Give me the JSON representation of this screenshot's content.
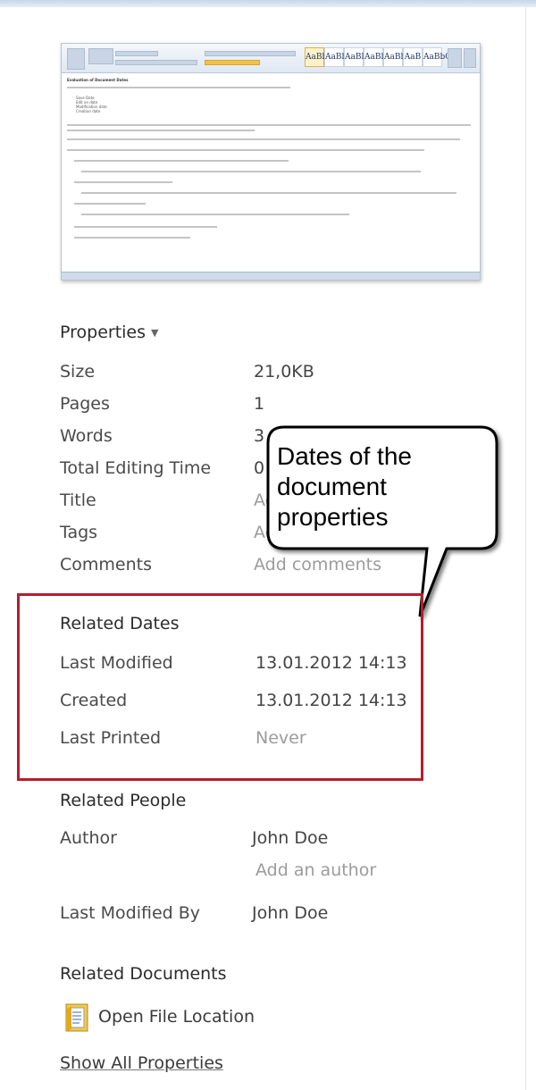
{
  "properties": {
    "header": "Properties",
    "rows": [
      {
        "label": "Size",
        "value": "21,0KB"
      },
      {
        "label": "Pages",
        "value": "1"
      },
      {
        "label": "Words",
        "value": "3"
      },
      {
        "label": "Total Editing Time",
        "value": "0 Minutes"
      },
      {
        "label": "Title",
        "value": "Add a title"
      },
      {
        "label": "Tags",
        "value": "Add a tag"
      },
      {
        "label": "Comments",
        "value": "Add comments"
      }
    ]
  },
  "related_dates": {
    "header": "Related Dates",
    "rows": [
      {
        "label": "Last Modified",
        "value": "13.01.2012 14:13"
      },
      {
        "label": "Created",
        "value": "13.01.2012 14:13"
      },
      {
        "label": "Last Printed",
        "value": "Never"
      }
    ]
  },
  "related_people": {
    "header": "Related People",
    "author_label": "Author",
    "author_value": "John Doe",
    "add_author": "Add an author",
    "last_modified_by_label": "Last Modified By",
    "last_modified_by_value": "John Doe"
  },
  "related_documents": {
    "header": "Related Documents",
    "open_file_location": "Open File Location"
  },
  "show_all_properties": "Show All Properties",
  "callout": {
    "line1": "Dates of the",
    "line2": "document",
    "line3": "properties"
  },
  "thumbnail": {
    "heading": "Evaluation of Document Dates",
    "list": [
      "Save Date",
      "Edit on date",
      "Modification date",
      "Creation date"
    ],
    "style_samples": [
      "AaBbCc",
      "AaBbCc",
      "AaBl",
      "AaBb",
      "AaBbC",
      "AaB",
      "AaBbCc"
    ]
  },
  "colors": {
    "highlight_border": "#b41e2b",
    "muted_text": "#9b9b9b"
  },
  "icons": {
    "properties_dropdown": "chevron-down-icon",
    "open_file_location": "folder-icon"
  }
}
